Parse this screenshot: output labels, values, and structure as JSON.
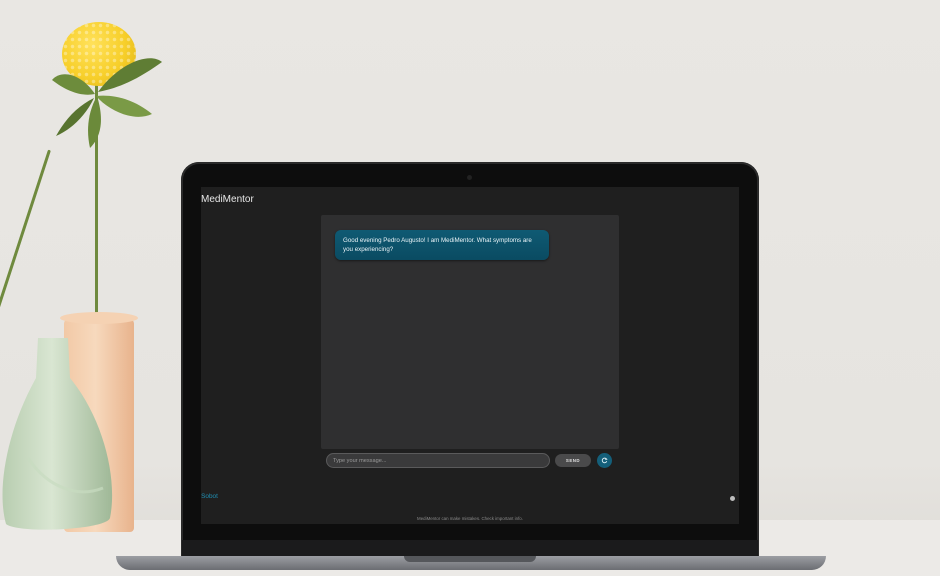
{
  "app": {
    "title": "MediMentor"
  },
  "chat": {
    "messages": [
      {
        "sender": "bot",
        "text": "Good evening Pedro Augusto! I am MediMentor. What symptoms are you experiencing?"
      }
    ]
  },
  "composer": {
    "placeholder": "Type your message...",
    "send_label": "SEND",
    "reset_icon": "refresh-icon"
  },
  "footer": {
    "back_link": "Sobot",
    "disclaimer": "MediMentor can make mistakes. Check important info."
  },
  "colors": {
    "accent": "#145f7a",
    "bubble": "#0f5a73",
    "link": "#1f8fb3",
    "screen_bg": "#1f1f1f",
    "panel_bg": "#2f2f30"
  }
}
